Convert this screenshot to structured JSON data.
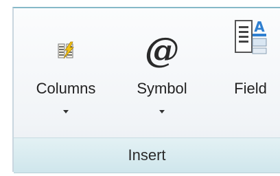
{
  "panel": {
    "title": "Insert"
  },
  "buttons": [
    {
      "label": "Columns",
      "icon": "columns-icon",
      "has_dropdown": true
    },
    {
      "label": "Symbol",
      "icon": "symbol-icon",
      "has_dropdown": true
    },
    {
      "label": "Field",
      "icon": "field-icon",
      "has_dropdown": false
    }
  ]
}
